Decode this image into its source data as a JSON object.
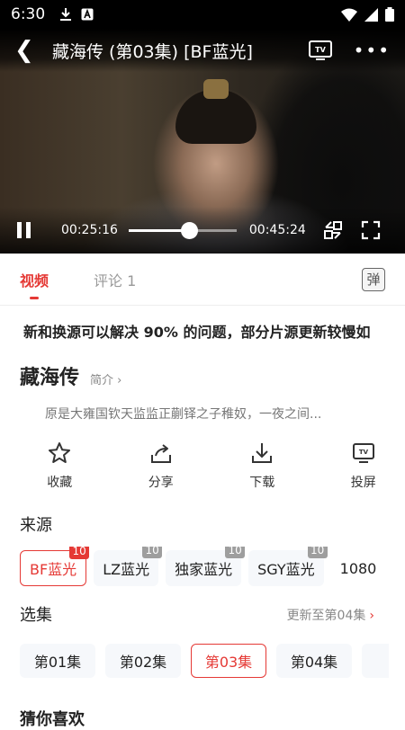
{
  "status": {
    "time": "6:30"
  },
  "player": {
    "title": "藏海传 (第03集) [BF蓝光]",
    "current_time": "00:25:16",
    "duration": "00:45:24",
    "progress": 0.56
  },
  "tabs": [
    {
      "label": "视频",
      "active": true
    },
    {
      "label": "评论 1",
      "active": false
    }
  ],
  "danmu_label": "弹",
  "marquee": "新和换源可以解决 90% 的问题，部分片源更新较慢如",
  "info": {
    "name": "藏海传",
    "intro_link": "简介",
    "description": "原是大雍国钦天监监正蒯铎之子稚奴，一夜之间..."
  },
  "actions": [
    {
      "label": "收藏",
      "icon": "star-icon"
    },
    {
      "label": "分享",
      "icon": "share-icon"
    },
    {
      "label": "下载",
      "icon": "download-icon"
    },
    {
      "label": "投屏",
      "icon": "tv-cast-icon"
    }
  ],
  "sources": {
    "title": "来源",
    "items": [
      {
        "label": "BF蓝光",
        "badge": "10",
        "active": true
      },
      {
        "label": "LZ蓝光",
        "badge": "10",
        "active": false
      },
      {
        "label": "独家蓝光",
        "badge": "10",
        "active": false
      },
      {
        "label": "SGY蓝光",
        "badge": "10",
        "active": false
      },
      {
        "label": "1080",
        "badge": "",
        "active": false
      }
    ]
  },
  "episodes": {
    "title": "选集",
    "update_text": "更新至第04集",
    "items": [
      {
        "label": "第01集",
        "active": false
      },
      {
        "label": "第02集",
        "active": false
      },
      {
        "label": "第03集",
        "active": true
      },
      {
        "label": "第04集",
        "active": false
      },
      {
        "label": "第",
        "active": false
      }
    ]
  },
  "guess_title": "猜你喜欢",
  "colors": {
    "accent": "#e53935",
    "chip_bg": "#f6f8fb"
  }
}
